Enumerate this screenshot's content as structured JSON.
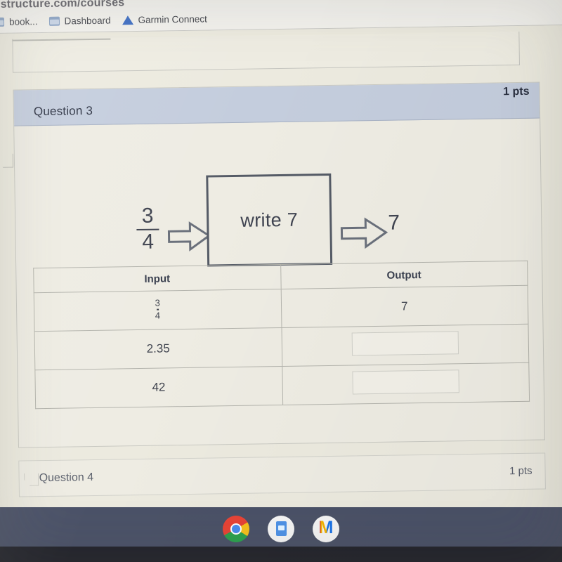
{
  "browser": {
    "url_text": "structure.com/courses",
    "bookmarks": [
      {
        "label": "book...",
        "icon": "folder-icon"
      },
      {
        "label": "Dashboard",
        "icon": "folder-icon"
      },
      {
        "label": "Garmin Connect",
        "icon": "triangle-icon"
      }
    ]
  },
  "question3": {
    "title": "Question 3",
    "points": "1 pts",
    "diagram": {
      "input_numerator": "3",
      "input_denominator": "4",
      "machine_label": "write 7",
      "output_value": "7"
    },
    "table": {
      "headers": [
        "Input",
        "Output"
      ],
      "rows": [
        {
          "input_numerator": "3",
          "input_denominator": "4",
          "input_is_fraction": true,
          "output": "7",
          "output_is_input_box": false
        },
        {
          "input": "2.35",
          "input_is_fraction": false,
          "output": "",
          "output_is_input_box": true
        },
        {
          "input": "42",
          "input_is_fraction": false,
          "output": "",
          "output_is_input_box": true
        }
      ]
    }
  },
  "question4": {
    "title": "Question 4",
    "points": "1 pts"
  },
  "shelf": {
    "apps": [
      {
        "name": "chrome-icon"
      },
      {
        "name": "google-slides-icon"
      },
      {
        "name": "gmail-icon"
      }
    ]
  },
  "colors": {
    "header_bar": "#c4cddd",
    "page_bg": "#eceadf",
    "shelf": "#4b5268",
    "diagram_stroke": "#555b66"
  }
}
